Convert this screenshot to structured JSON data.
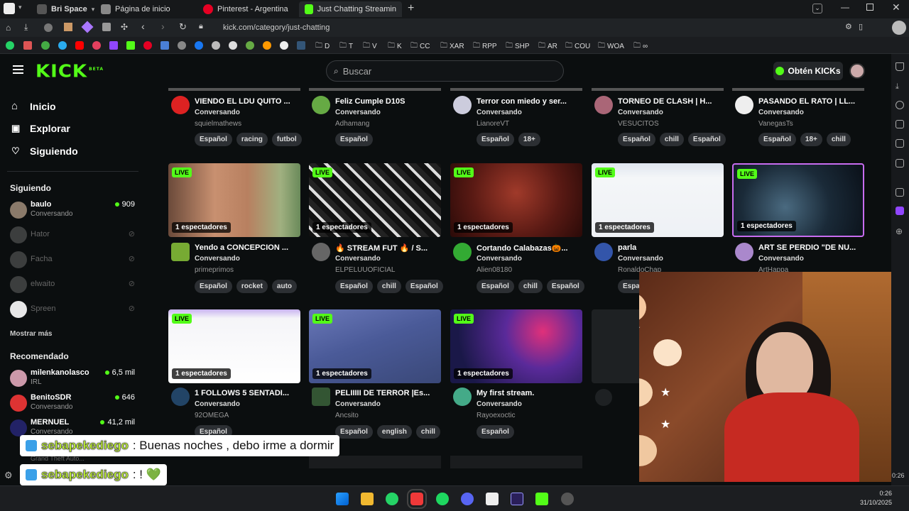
{
  "browser": {
    "profile_tab": "Bri Space",
    "tabs": [
      {
        "label": "Página de inicio"
      },
      {
        "label": "Pinterest - Argentina"
      },
      {
        "label": "Just Chatting Streaming - L"
      }
    ],
    "url": "kick.com/category/just-chatting",
    "bookmarks": [
      "D",
      "T",
      "V",
      "K",
      "CC",
      "XAR",
      "RPP",
      "SHP",
      "AR",
      "COU",
      "WOA"
    ]
  },
  "header": {
    "logo": "KICK",
    "logo_beta": "BETA",
    "search_placeholder": "Buscar",
    "get_kicks": "Obtén KICKs"
  },
  "sidebar": {
    "nav": [
      {
        "label": "Inicio",
        "icon": "home-icon"
      },
      {
        "label": "Explorar",
        "icon": "compass-icon"
      },
      {
        "label": "Siguiendo",
        "icon": "heart-icon"
      }
    ],
    "following_title": "Siguiendo",
    "following": [
      {
        "name": "baulo",
        "sub": "Conversando",
        "viewers": "909",
        "online": true
      },
      {
        "name": "Hator",
        "online": false
      },
      {
        "name": "Facha",
        "online": false
      },
      {
        "name": "elwaito",
        "online": false
      },
      {
        "name": "Spreen",
        "online": false
      }
    ],
    "show_more": "Mostrar más",
    "recommended_title": "Recomendado",
    "recommended": [
      {
        "name": "milenkanolasco",
        "sub": "IRL",
        "viewers": "6,5 mil"
      },
      {
        "name": "BenitoSDR",
        "sub": "Conversando",
        "viewers": "646"
      },
      {
        "name": "MERNUEL",
        "sub": "Conversando",
        "viewers": "41,2 mil"
      }
    ],
    "hidden_sub": "Grand Theft Auto..."
  },
  "grid": {
    "live_label": "LIVE",
    "row0": [
      {
        "title": "VIENDO EL LDU QUITO ...",
        "category": "Conversando",
        "channel": "squielmathews",
        "tags": [
          "Español",
          "racing",
          "futbol"
        ]
      },
      {
        "title": "Feliz Cumple D10S",
        "category": "Conversando",
        "channel": "Adhamang",
        "tags": [
          "Español"
        ]
      },
      {
        "title": "Terror con miedo y ser...",
        "category": "Conversando",
        "channel": "LianoreVT",
        "tags": [
          "Español",
          "18+"
        ]
      },
      {
        "title": "TORNEO DE CLASH | H...",
        "category": "Conversando",
        "channel": "VESUCITOS",
        "tags": [
          "Español",
          "chill",
          "Español"
        ]
      },
      {
        "title": "PASANDO EL RATO | LL...",
        "category": "Conversando",
        "channel": "VanegasTs",
        "tags": [
          "Español",
          "18+",
          "chill"
        ]
      }
    ],
    "row1": [
      {
        "viewers": "1 espectadores",
        "title": "Yendo a CONCEPCION ...",
        "category": "Conversando",
        "channel": "primeprimos",
        "tags": [
          "Español",
          "rocket",
          "auto"
        ]
      },
      {
        "viewers": "1 espectadores",
        "title": "🔥 STREAM FUT 🔥 / S...",
        "category": "Conversando",
        "channel": "ELPELUUOFICIAL",
        "tags": [
          "Español",
          "chill",
          "Español"
        ]
      },
      {
        "viewers": "1 espectadores",
        "title": "Cortando Calabazas🎃...",
        "category": "Conversando",
        "channel": "Alien08180",
        "tags": [
          "Español",
          "chill",
          "Español"
        ]
      },
      {
        "viewers": "1 espectadores",
        "title": "parla",
        "category": "Conversando",
        "channel": "RonaldoChap",
        "tags": [
          "Espa"
        ]
      },
      {
        "viewers": "1 espectadores",
        "title": "ART SE PERDIO \"DE NU...",
        "category": "Conversando",
        "channel": "ArtHappa",
        "tags": []
      }
    ],
    "row2": [
      {
        "viewers": "1 espectadores",
        "title": "1 FOLLOWS 5 SENTADI...",
        "category": "Conversando",
        "channel": "92OMEGA",
        "tags": [
          "Español"
        ]
      },
      {
        "viewers": "1 espectadores",
        "title": "PELIIIII DE TERROR |Es...",
        "category": "Conversando",
        "channel": "Ancsito",
        "tags": [
          "Español",
          "english",
          "chill"
        ]
      },
      {
        "viewers": "1 espectadores",
        "title": "My first stream.",
        "category": "Conversando",
        "channel": "Rayoexoctic",
        "tags": [
          "Español"
        ]
      }
    ]
  },
  "chat": [
    {
      "user": "sebapekediego",
      "text": ": Buenas noches , debo irme a dormir"
    },
    {
      "user": "sebapekediego",
      "text": ": ! 💚"
    }
  ],
  "overlay_time": "0:26",
  "taskbar": {
    "time": "0:26",
    "date": "31/10/2025"
  },
  "colors": {
    "kick_green": "#53fc18",
    "bg": "#0b0e0f",
    "tag_bg": "#2c2f33"
  }
}
